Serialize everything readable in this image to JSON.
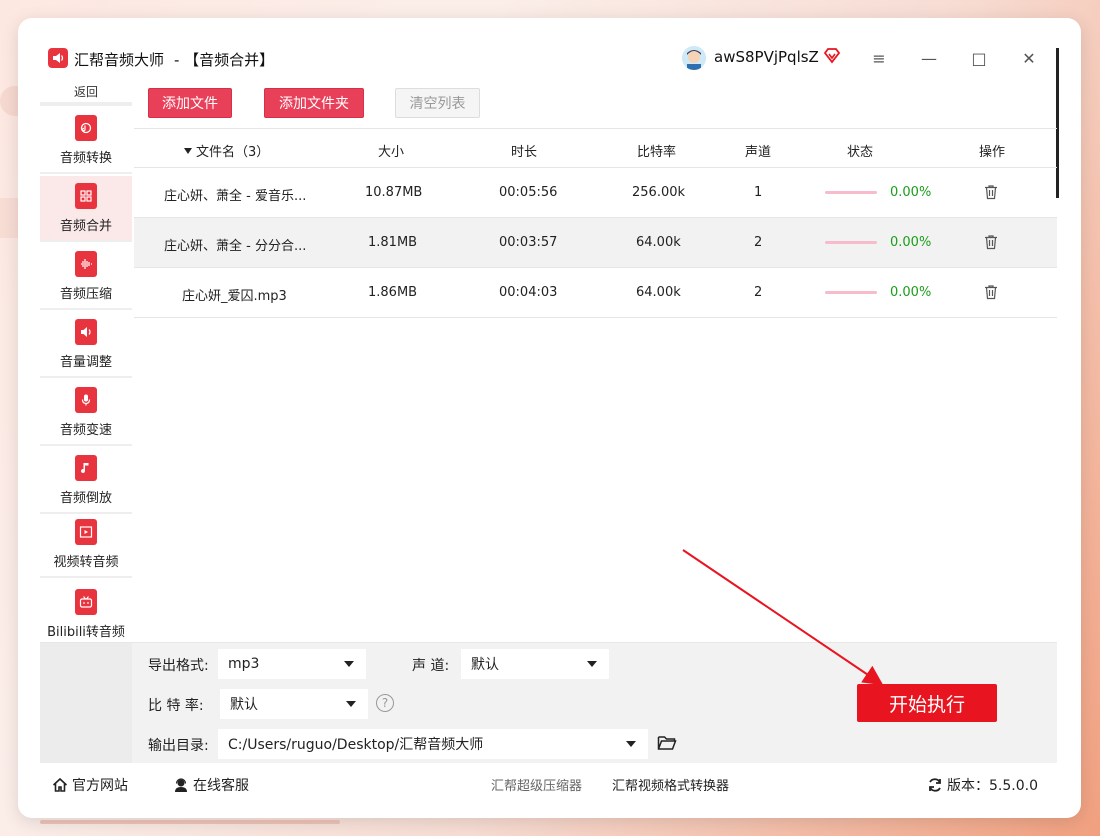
{
  "app": {
    "title": "汇帮音频大师",
    "module": "-  【音频合并】",
    "username": "awS8PVjPqlsZ"
  },
  "window_controls": {
    "menu": "≡",
    "minimize": "—",
    "maximize": "□",
    "close": "✕"
  },
  "sidebar": {
    "back_label": "返回",
    "items": [
      {
        "label": "音频转换",
        "icon": "audio-convert-icon"
      },
      {
        "label": "音频合并",
        "icon": "audio-merge-icon",
        "active": true
      },
      {
        "label": "音频压缩",
        "icon": "audio-compress-icon"
      },
      {
        "label": "音量调整",
        "icon": "volume-adjust-icon"
      },
      {
        "label": "音频变速",
        "icon": "audio-speed-icon"
      },
      {
        "label": "音频倒放",
        "icon": "audio-reverse-icon"
      },
      {
        "label": "视频转音频",
        "icon": "video-to-audio-icon"
      },
      {
        "label": "Bilibili转音频",
        "icon": "bilibili-icon"
      }
    ]
  },
  "toolbar": {
    "add_file": "添加文件",
    "add_folder": "添加文件夹",
    "clear_list": "清空列表"
  },
  "table": {
    "headers": [
      "文件名（3）",
      "大小",
      "时长",
      "比特率",
      "声道",
      "状态",
      "操作"
    ],
    "rows": [
      {
        "name": "庄心妍、萧全 - 爱音乐...",
        "size": "10.87MB",
        "duration": "00:05:56",
        "bitrate": "256.00k",
        "channels": "1",
        "progress": "0.00%"
      },
      {
        "name": "庄心妍、萧全 - 分分合...",
        "size": "1.81MB",
        "duration": "00:03:57",
        "bitrate": "64.00k",
        "channels": "2",
        "progress": "0.00%"
      },
      {
        "name": "庄心妍_爱囚.mp3",
        "size": "1.86MB",
        "duration": "00:04:03",
        "bitrate": "64.00k",
        "channels": "2",
        "progress": "0.00%"
      }
    ]
  },
  "settings": {
    "format_label": "导出格式:",
    "format_value": "mp3",
    "channel_label": "声  道:",
    "channel_value": "默认",
    "bitrate_label": "比 特 率:",
    "bitrate_value": "默认",
    "help": "?",
    "output_label": "输出目录:",
    "output_value": "C:/Users/ruguo/Desktop/汇帮音频大师"
  },
  "start_button": "开始执行",
  "footer": {
    "website": "官方网站",
    "support": "在线客服",
    "link1": "汇帮超级压缩器",
    "link2": "汇帮视频格式转换器",
    "version": "版本：5.5.0.0"
  },
  "colors": {
    "accent": "#e9405a",
    "start": "#e8141f",
    "progress_text": "#1a9e1a"
  }
}
